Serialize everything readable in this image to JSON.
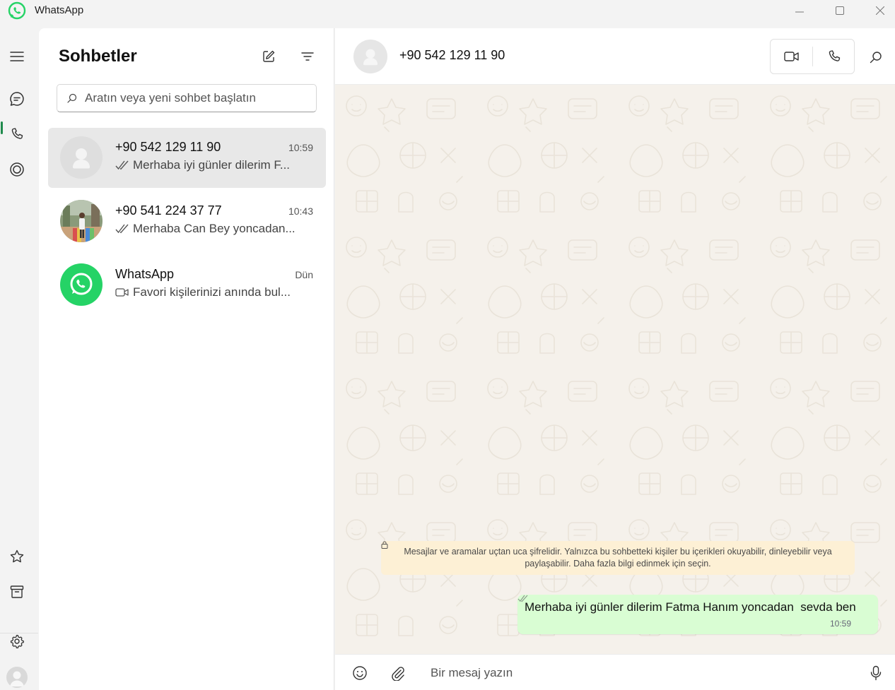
{
  "window": {
    "title": "WhatsApp",
    "controls": [
      "minimize-icon",
      "maximize-icon",
      "close-icon"
    ]
  },
  "rail": {
    "items": [
      {
        "name": "menu",
        "icon": "hamburger-icon"
      },
      {
        "name": "chats",
        "icon": "chat-bubble-icon",
        "active": true
      },
      {
        "name": "calls",
        "icon": "phone-icon"
      },
      {
        "name": "status",
        "icon": "status-ring-icon"
      },
      {
        "name": "starred",
        "icon": "star-icon"
      },
      {
        "name": "archived",
        "icon": "archive-icon"
      },
      {
        "name": "settings",
        "icon": "gear-icon"
      },
      {
        "name": "profile",
        "icon": "avatar-icon"
      }
    ]
  },
  "chatlist": {
    "title": "Sohbetler",
    "search_placeholder": "Aratın veya yeni sohbet başlatın",
    "chats": [
      {
        "name": "+90 542 129 11 90",
        "time": "10:59",
        "preview": "Merhaba iyi günler dilerim F...",
        "preview_icon": "double-check-icon",
        "avatar": "default",
        "selected": true
      },
      {
        "name": "+90 541 224 37 77",
        "time": "10:43",
        "preview": "Merhaba Can Bey yoncadan...",
        "preview_icon": "double-check-icon",
        "avatar": "photo",
        "selected": false
      },
      {
        "name": "WhatsApp",
        "time": "Dün",
        "preview": "Favori kişilerinizi anında bul...",
        "preview_icon": "video-icon",
        "avatar": "whatsapp-logo",
        "selected": false
      }
    ]
  },
  "conversation": {
    "contact_name": "+90 542 129 11 90",
    "encryption_notice": "Mesajlar ve aramalar uçtan uca şifrelidir. Yalnızca bu sohbetteki kişiler bu içerikleri okuyabilir, dinleyebilir veya paylaşabilir. Daha fazla bilgi edinmek için seçin.",
    "messages": [
      {
        "text": "Merhaba iyi günler dilerim Fatma Hanım yoncadan  sevda ben",
        "time": "10:59",
        "status": "read",
        "outgoing": true
      }
    ],
    "composer_placeholder": "Bir mesaj yazın"
  },
  "colors": {
    "accent": "#1f8a4c",
    "whatsapp_green": "#25d366",
    "outgoing_bubble": "#d9fdd3",
    "notice_bg": "#fdf0d5",
    "wallpaper": "#f5f1eb"
  }
}
